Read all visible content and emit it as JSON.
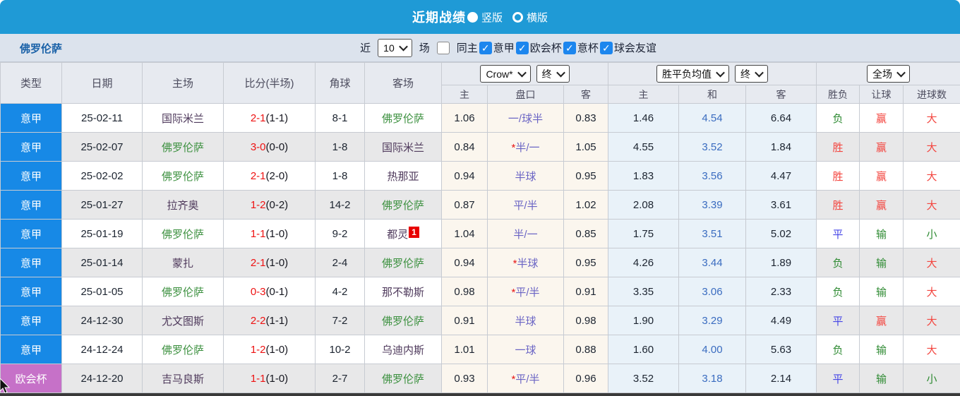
{
  "colors": {
    "accent_blue": "#1f9ad6",
    "league_blue": "#1789e6",
    "league_purple": "#c671c8",
    "self_team_green": "#3d9140",
    "score_red": "#ee1212",
    "win_red": "#f3453f",
    "loss_green": "#2f8b33",
    "draw_blue": "#4646e6"
  },
  "title_bar": {
    "title": "近期战绩",
    "radio_vertical": "竖版",
    "radio_horizontal": "横版"
  },
  "toolbar": {
    "team_name": "佛罗伦萨",
    "recent_label": "近",
    "recent_count": "10",
    "matches_label": "场",
    "same_home_label": "同主",
    "filters": [
      {
        "label": "意甲",
        "checked": true
      },
      {
        "label": "欧会杯",
        "checked": true
      },
      {
        "label": "意杯",
        "checked": true
      },
      {
        "label": "球会友谊",
        "checked": true
      }
    ]
  },
  "controls": {
    "odds_source": "Crow*",
    "odds_state": "终",
    "avg_label": "胜平负均值",
    "avg_state": "终",
    "scope": "全场"
  },
  "table": {
    "headers": {
      "type": "类型",
      "date": "日期",
      "home": "主场",
      "score": "比分(半场)",
      "corner": "角球",
      "away": "客场",
      "h": "主",
      "handicap": "盘口",
      "a": "客",
      "avg_h": "主",
      "avg_d": "和",
      "avg_a": "客",
      "result": "胜负",
      "handicap_result": "让球",
      "goals": "进球数"
    },
    "rows": [
      {
        "league": "意甲",
        "league_color": "blue",
        "date": "25-02-11",
        "home": "国际米兰",
        "home_self": false,
        "score": "2-1",
        "half": "(1-1)",
        "corner": "8-1",
        "away": "佛罗伦萨",
        "away_self": true,
        "away_badge": "",
        "odds_h": "1.06",
        "handicap": "一/球半",
        "handicap_star": false,
        "odds_a": "0.83",
        "avg_h": "1.46",
        "avg_d": "4.54",
        "avg_a": "6.64",
        "result": "负",
        "result_color": "green",
        "let": "赢",
        "let_color": "red",
        "goal": "大",
        "goal_color": "red"
      },
      {
        "league": "意甲",
        "league_color": "blue",
        "date": "25-02-07",
        "home": "佛罗伦萨",
        "home_self": true,
        "score": "3-0",
        "half": "(0-0)",
        "corner": "1-8",
        "away": "国际米兰",
        "away_self": false,
        "away_badge": "",
        "odds_h": "0.84",
        "handicap": "半/一",
        "handicap_star": true,
        "odds_a": "1.05",
        "avg_h": "4.55",
        "avg_d": "3.52",
        "avg_a": "1.84",
        "result": "胜",
        "result_color": "red",
        "let": "赢",
        "let_color": "red",
        "goal": "大",
        "goal_color": "red"
      },
      {
        "league": "意甲",
        "league_color": "blue",
        "date": "25-02-02",
        "home": "佛罗伦萨",
        "home_self": true,
        "score": "2-1",
        "half": "(2-0)",
        "corner": "1-8",
        "away": "热那亚",
        "away_self": false,
        "away_badge": "",
        "odds_h": "0.94",
        "handicap": "半球",
        "handicap_star": false,
        "odds_a": "0.95",
        "avg_h": "1.83",
        "avg_d": "3.56",
        "avg_a": "4.47",
        "result": "胜",
        "result_color": "red",
        "let": "赢",
        "let_color": "red",
        "goal": "大",
        "goal_color": "red"
      },
      {
        "league": "意甲",
        "league_color": "blue",
        "date": "25-01-27",
        "home": "拉齐奥",
        "home_self": false,
        "score": "1-2",
        "half": "(0-2)",
        "corner": "14-2",
        "away": "佛罗伦萨",
        "away_self": true,
        "away_badge": "",
        "odds_h": "0.87",
        "handicap": "平/半",
        "handicap_star": false,
        "odds_a": "1.02",
        "avg_h": "2.08",
        "avg_d": "3.39",
        "avg_a": "3.61",
        "result": "胜",
        "result_color": "red",
        "let": "赢",
        "let_color": "red",
        "goal": "大",
        "goal_color": "red"
      },
      {
        "league": "意甲",
        "league_color": "blue",
        "date": "25-01-19",
        "home": "佛罗伦萨",
        "home_self": true,
        "score": "1-1",
        "half": "(1-0)",
        "corner": "9-2",
        "away": "都灵",
        "away_self": false,
        "away_badge": "1",
        "odds_h": "1.04",
        "handicap": "半/一",
        "handicap_star": false,
        "odds_a": "0.85",
        "avg_h": "1.75",
        "avg_d": "3.51",
        "avg_a": "5.02",
        "result": "平",
        "result_color": "blue",
        "let": "输",
        "let_color": "green",
        "goal": "小",
        "goal_color": "green"
      },
      {
        "league": "意甲",
        "league_color": "blue",
        "date": "25-01-14",
        "home": "蒙扎",
        "home_self": false,
        "score": "2-1",
        "half": "(1-0)",
        "corner": "2-4",
        "away": "佛罗伦萨",
        "away_self": true,
        "away_badge": "",
        "odds_h": "0.94",
        "handicap": "半球",
        "handicap_star": true,
        "odds_a": "0.95",
        "avg_h": "4.26",
        "avg_d": "3.44",
        "avg_a": "1.89",
        "result": "负",
        "result_color": "green",
        "let": "输",
        "let_color": "green",
        "goal": "大",
        "goal_color": "red"
      },
      {
        "league": "意甲",
        "league_color": "blue",
        "date": "25-01-05",
        "home": "佛罗伦萨",
        "home_self": true,
        "score": "0-3",
        "half": "(0-1)",
        "corner": "4-2",
        "away": "那不勒斯",
        "away_self": false,
        "away_badge": "",
        "odds_h": "0.98",
        "handicap": "平/半",
        "handicap_star": true,
        "odds_a": "0.91",
        "avg_h": "3.35",
        "avg_d": "3.06",
        "avg_a": "2.33",
        "result": "负",
        "result_color": "green",
        "let": "输",
        "let_color": "green",
        "goal": "大",
        "goal_color": "red"
      },
      {
        "league": "意甲",
        "league_color": "blue",
        "date": "24-12-30",
        "home": "尤文图斯",
        "home_self": false,
        "score": "2-2",
        "half": "(1-1)",
        "corner": "7-2",
        "away": "佛罗伦萨",
        "away_self": true,
        "away_badge": "",
        "odds_h": "0.91",
        "handicap": "半球",
        "handicap_star": false,
        "odds_a": "0.98",
        "avg_h": "1.90",
        "avg_d": "3.29",
        "avg_a": "4.49",
        "result": "平",
        "result_color": "blue",
        "let": "赢",
        "let_color": "red",
        "goal": "大",
        "goal_color": "red"
      },
      {
        "league": "意甲",
        "league_color": "blue",
        "date": "24-12-24",
        "home": "佛罗伦萨",
        "home_self": true,
        "score": "1-2",
        "half": "(1-0)",
        "corner": "10-2",
        "away": "乌迪内斯",
        "away_self": false,
        "away_badge": "",
        "odds_h": "1.01",
        "handicap": "一球",
        "handicap_star": false,
        "odds_a": "0.88",
        "avg_h": "1.60",
        "avg_d": "4.00",
        "avg_a": "5.63",
        "result": "负",
        "result_color": "green",
        "let": "输",
        "let_color": "green",
        "goal": "大",
        "goal_color": "red"
      },
      {
        "league": "欧会杯",
        "league_color": "purple",
        "date": "24-12-20",
        "home": "吉马良斯",
        "home_self": false,
        "score": "1-1",
        "half": "(1-0)",
        "corner": "2-7",
        "away": "佛罗伦萨",
        "away_self": true,
        "away_badge": "",
        "odds_h": "0.93",
        "handicap": "平/半",
        "handicap_star": true,
        "odds_a": "0.96",
        "avg_h": "3.52",
        "avg_d": "3.18",
        "avg_a": "2.14",
        "result": "平",
        "result_color": "blue",
        "let": "输",
        "let_color": "green",
        "goal": "小",
        "goal_color": "green"
      }
    ]
  }
}
